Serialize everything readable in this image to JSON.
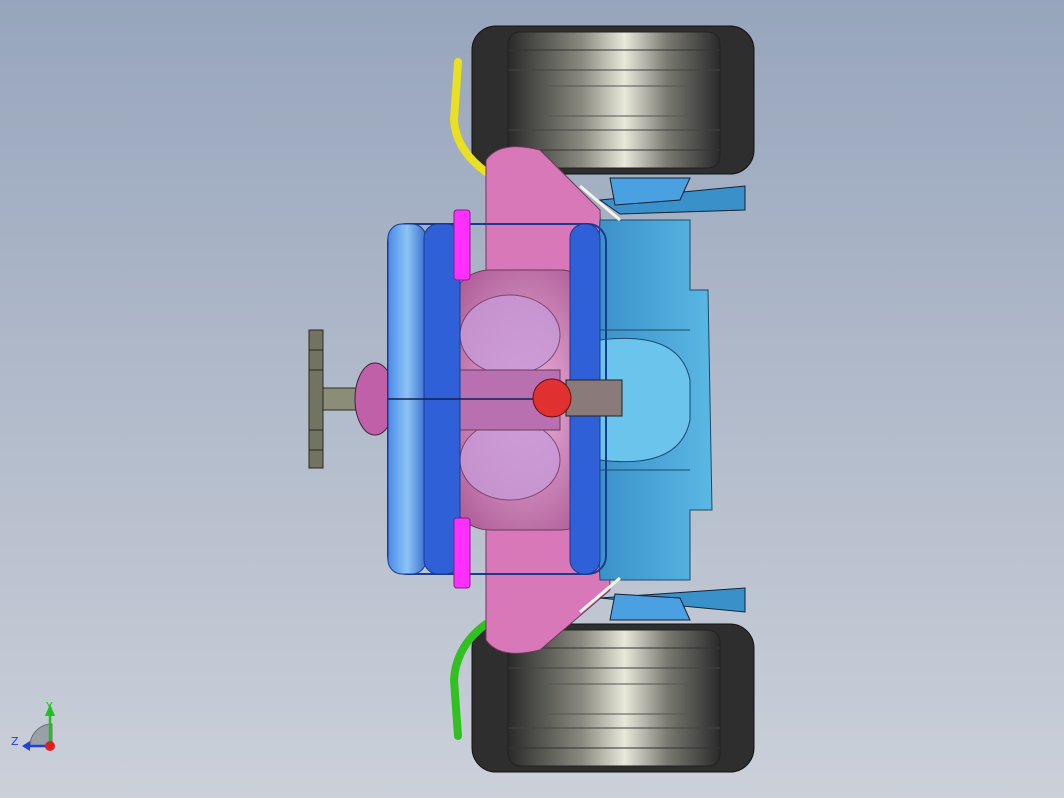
{
  "viewport": {
    "background_top": "#9aa7bd",
    "background_bottom": "#c9ced8",
    "model": "race-car-rear-view"
  },
  "colors": {
    "tire": "#3c3c3c",
    "tire_highlight": "#d8d8c8",
    "body_pink": "#d877b8",
    "wing_blue": "#3f7fe0",
    "wing_light": "#7fb8f0",
    "sidepod_blue": "#58b0e0",
    "light_red": "#e03030",
    "magenta_strip": "#ff30ff",
    "yellow_pipe": "#e8e020",
    "green_pipe": "#30c020",
    "stand": "#6c7060"
  },
  "triad": {
    "axis_y_label": "Y",
    "axis_z_label": "Z",
    "y_color": "#20c020",
    "z_color": "#2040e0",
    "origin_color": "#e02020"
  }
}
